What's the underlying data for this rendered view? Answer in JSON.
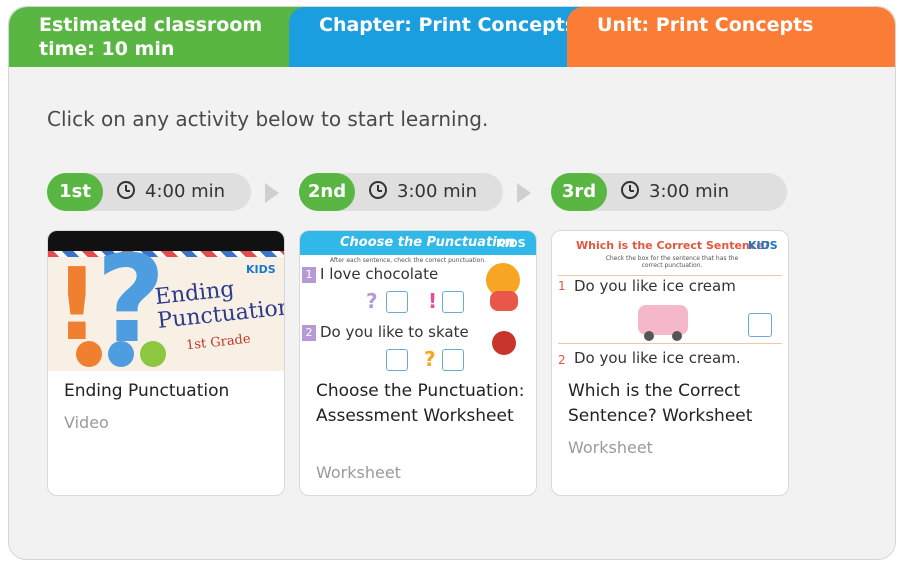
{
  "header": {
    "tabs": [
      {
        "label": "Estimated classroom time: 10 min",
        "color": "#5ab642"
      },
      {
        "label": "Chapter: Print Concepts",
        "color": "#1b9ee0"
      },
      {
        "label": "Unit: Print Concepts",
        "color": "#fb7c35"
      }
    ]
  },
  "intro": "Click on any activity below to start learning.",
  "steps": [
    {
      "order": "1st",
      "duration": "4:00 min"
    },
    {
      "order": "2nd",
      "duration": "3:00 min"
    },
    {
      "order": "3rd",
      "duration": "3:00 min"
    }
  ],
  "cards": [
    {
      "title": "Ending Punctuation",
      "type": "Video",
      "thumb": {
        "heading_1": "Ending",
        "heading_2": "Punctuation",
        "grade": "1st Grade",
        "logo": "KIDS"
      }
    },
    {
      "title": "Choose the Punctuation: Assessment Worksheet",
      "type": "Worksheet",
      "thumb": {
        "heading": "Choose the Punctuation",
        "logo": "KIDS",
        "instruction": "After each sentence, check the correct punctuation.",
        "item1_num": "1",
        "item1": "I love chocolate",
        "item2_num": "2",
        "item2": "Do you like to skate"
      }
    },
    {
      "title": "Which is the Correct Sentence? Worksheet",
      "type": "Worksheet",
      "thumb": {
        "heading": "Which is the Correct Sentence?",
        "logo": "KIDS",
        "instruction": "Check the box for the sentence that has the correct punctuation.",
        "item1_num": "1",
        "item1": "Do you like ice cream",
        "item2_num": "2",
        "item2": "Do you like ice cream."
      }
    }
  ],
  "colors": {
    "step_badge": "#5ab642",
    "step_pill": "#dfdfdf",
    "panel_bg": "#f2f2f2"
  },
  "icons": [
    "clock-icon",
    "chevron-right-icon"
  ]
}
